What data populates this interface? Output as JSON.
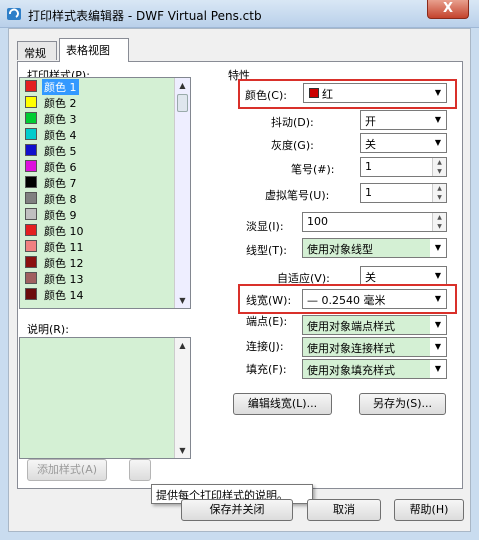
{
  "window": {
    "title": "打印样式表编辑器 - DWF Virtual Pens.ctb",
    "close_label": "X"
  },
  "tabs": [
    {
      "label": "常规"
    },
    {
      "label": "表格视图"
    }
  ],
  "left": {
    "styles_label": "打印样式(P):",
    "description_label": "说明(R):",
    "styles": [
      {
        "name": "颜色 1",
        "color": "#e32020",
        "selected": true
      },
      {
        "name": "颜色 2",
        "color": "#ffff00"
      },
      {
        "name": "颜色 3",
        "color": "#00cc33"
      },
      {
        "name": "颜色 4",
        "color": "#00cccc"
      },
      {
        "name": "颜色 5",
        "color": "#1010cc"
      },
      {
        "name": "颜色 6",
        "color": "#dd10dd"
      },
      {
        "name": "颜色 7",
        "color": "#000000"
      },
      {
        "name": "颜色 8",
        "color": "#808080"
      },
      {
        "name": "颜色 9",
        "color": "#c0c0c0"
      },
      {
        "name": "颜色 10",
        "color": "#e32020"
      },
      {
        "name": "颜色 11",
        "color": "#f08080"
      },
      {
        "name": "颜色 12",
        "color": "#8b1010"
      },
      {
        "name": "颜色 13",
        "color": "#a06060"
      },
      {
        "name": "颜色 14",
        "color": "#6b0d0d"
      }
    ]
  },
  "properties": {
    "section_label": "特性",
    "color": {
      "label": "颜色(C):",
      "value": "红",
      "swatch": "#cc0000"
    },
    "dither": {
      "label": "抖动(D):",
      "value": "开"
    },
    "grayscale": {
      "label": "灰度(G):",
      "value": "关"
    },
    "pen": {
      "label": "笔号(#):",
      "value": "1"
    },
    "virtual_pen": {
      "label": "虚拟笔号(U):",
      "value": "1"
    },
    "screening": {
      "label": "淡显(I):",
      "value": "100"
    },
    "linetype": {
      "label": "线型(T):",
      "value": "使用对象线型"
    },
    "adaptive": {
      "label": "自适应(V):",
      "value": "关"
    },
    "lineweight": {
      "label": "线宽(W):",
      "value": "— 0.2540 毫米"
    },
    "endstyle": {
      "label": "端点(E):",
      "value": "使用对象端点样式"
    },
    "joinstyle": {
      "label": "连接(J):",
      "value": "使用对象连接样式"
    },
    "fillstyle": {
      "label": "填充(F):",
      "value": "使用对象填充样式"
    }
  },
  "buttons": {
    "edit_lineweights": "编辑线宽(L)...",
    "save_as": "另存为(S)...",
    "add_style": "添加样式(A)",
    "save_close": "保存并关闭",
    "cancel": "取消",
    "help": "帮助(H)"
  },
  "tooltip": "提供每个打印样式的说明。"
}
